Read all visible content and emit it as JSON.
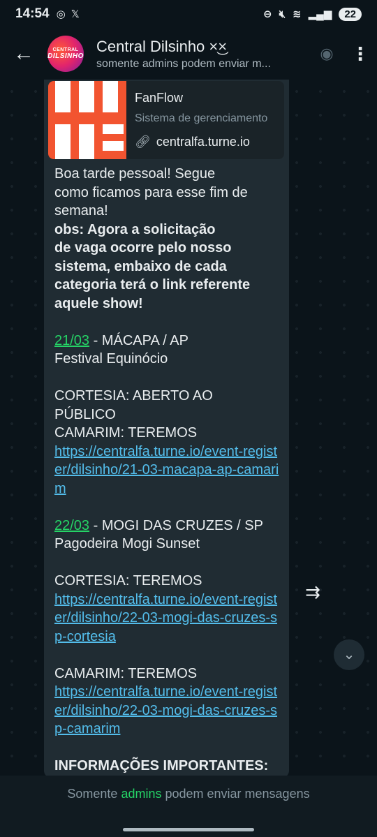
{
  "status_bar": {
    "time": "14:54",
    "battery": "22",
    "icons": [
      "whatsapp-icon",
      "x-icon",
      "dnd-icon",
      "mute-icon",
      "wifi-icon",
      "signal-icon"
    ]
  },
  "header": {
    "back_icon": "arrow-back-icon",
    "avatar_line1": "CENTRAL",
    "avatar_line2": "DILSINHO",
    "title": "Central Dilsinho ×͜×",
    "subtitle": "somente admins podem enviar m..."
  },
  "preview": {
    "title": "FanFlow",
    "description": "Sistema de gerenciamento",
    "link": "centralfa.turne.io"
  },
  "message": {
    "intro1": "Boa tarde pessoal! Segue",
    "intro2": "como ficamos para esse fim de",
    "intro3": "semana!",
    "obs1": "obs: Agora a solicitação",
    "obs2": "de vaga ocorre pelo nosso",
    "obs3": "sistema, embaixo de cada",
    "obs4": "categoria terá o link referente",
    "obs5": "aquele show!",
    "ev1_date": "21/03",
    "ev1_place": " - MÁCAPA / AP",
    "ev1_name": "Festival Equinócio",
    "ev1_cortesia1": "CORTESIA: ABERTO AO",
    "ev1_cortesia2": "PÚBLICO",
    "ev1_camarim": "CAMARIM: TEREMOS",
    "ev1_link": "https://centralfa.turne.io/event-register/dilsinho/21-03-macapa-ap-camarim",
    "ev2_date": "22/03",
    "ev2_place": " - MOGI DAS CRUZES / SP",
    "ev2_name": "Pagodeira Mogi Sunset",
    "ev2_cortesia": "CORTESIA: TEREMOS",
    "ev2_cortesia_link": "https://centralfa.turne.io/event-register/dilsinho/22-03-mogi-das-cruzes-sp-cortesia",
    "ev2_camarim": "CAMARIM: TEREMOS",
    "ev2_camarim_link": "https://centralfa.turne.io/event-register/dilsinho/22-03-mogi-das-cruzes-sp-camarim",
    "important": "INFORMAÇÕES IMPORTANTES:"
  },
  "footer": {
    "pre": "Somente ",
    "admins": "admins",
    "post": " podem enviar mensagens"
  },
  "colors": {
    "background": "#0b141a",
    "bubble": "#202c33",
    "link": "#53bdeb",
    "accent_green": "#25d366"
  }
}
